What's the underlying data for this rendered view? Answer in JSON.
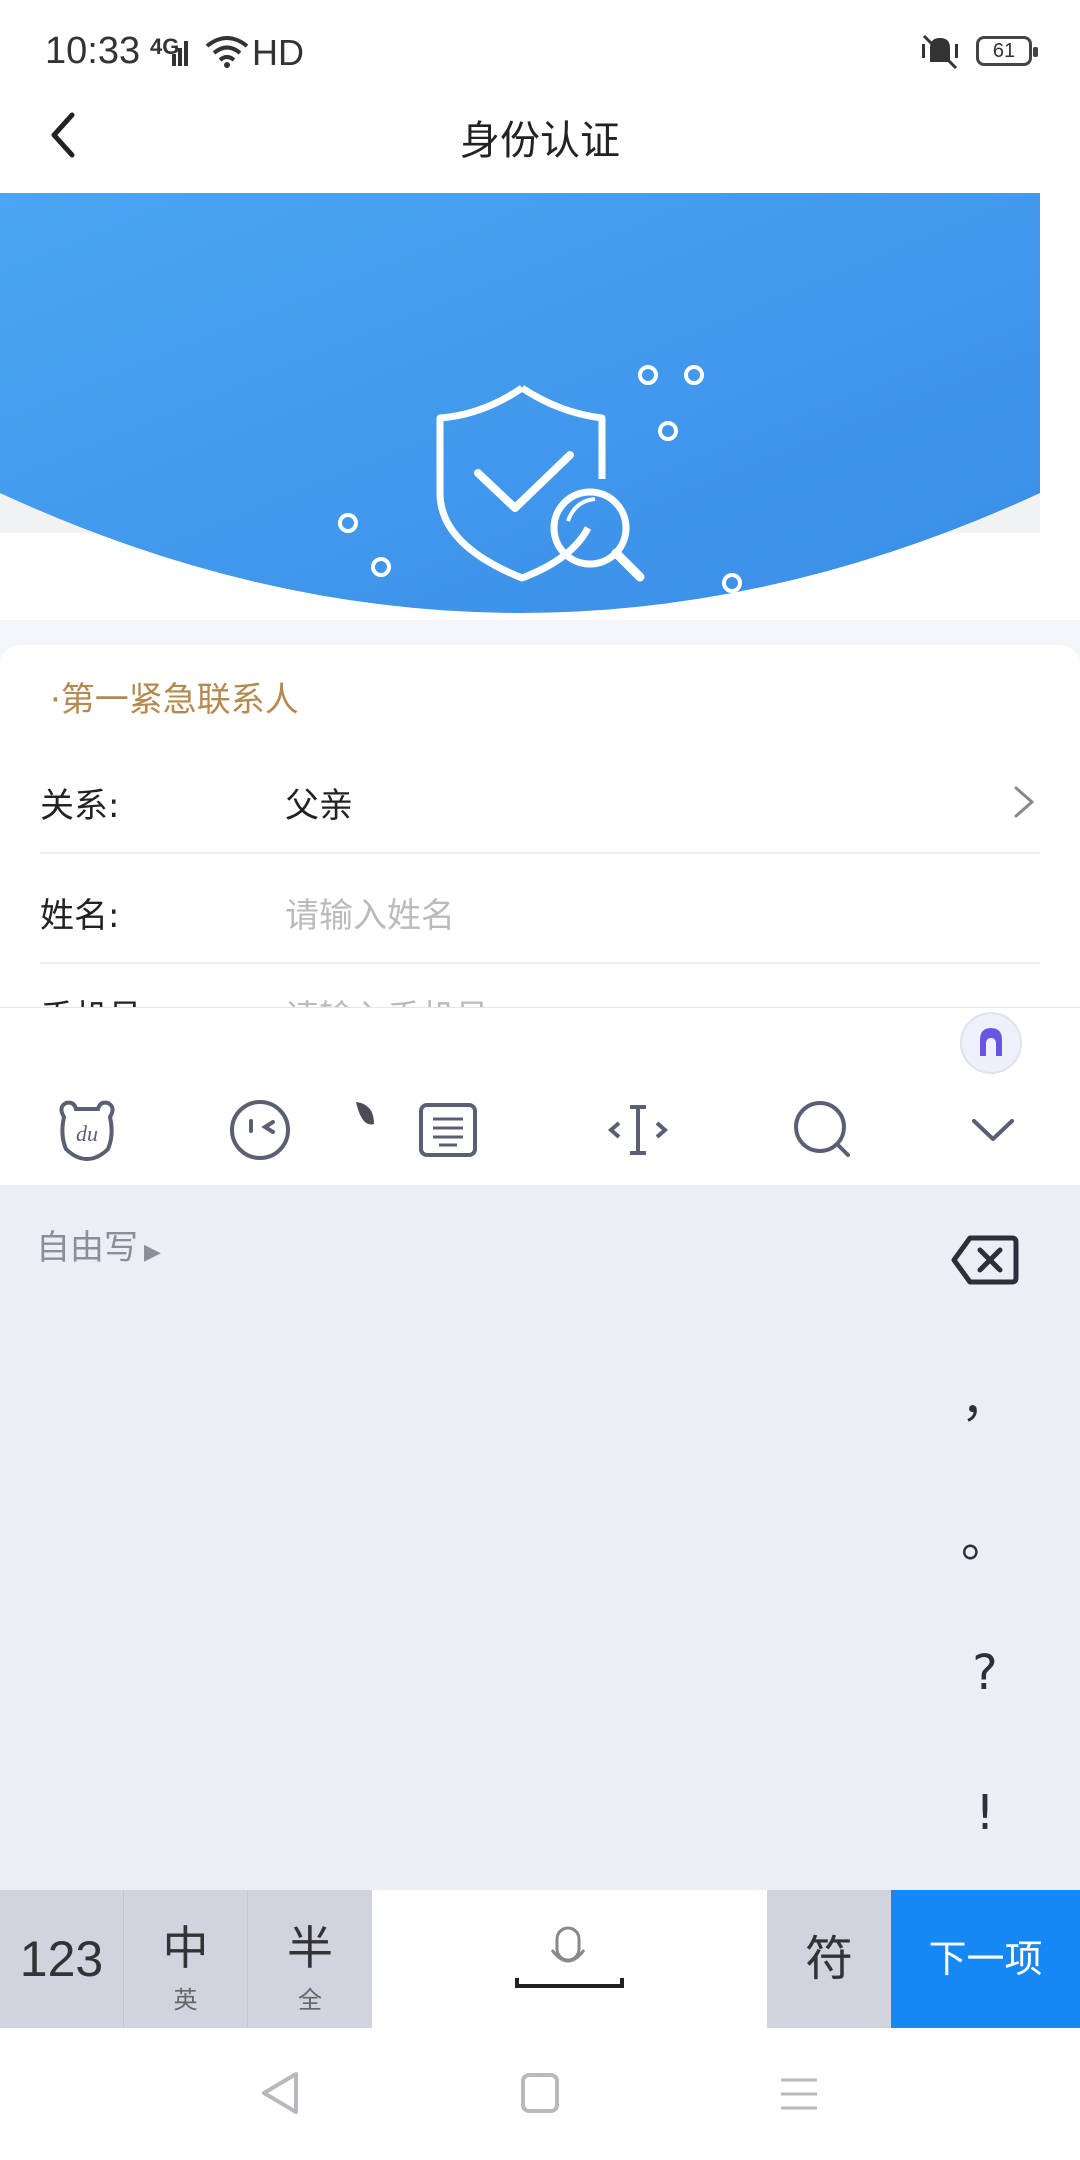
{
  "status_bar": {
    "time": "10:33",
    "network": "4G",
    "signal_label": "HD",
    "battery": "61"
  },
  "header": {
    "title": "身份认证"
  },
  "section": {
    "title": "·第一紧急联系人"
  },
  "form": {
    "relation": {
      "label": "关系:",
      "value": "父亲"
    },
    "name": {
      "label": "姓名:",
      "placeholder": "请输入姓名"
    },
    "phone": {
      "label": "手机号:",
      "placeholder": "请输入手机号"
    }
  },
  "keyboard": {
    "toolbar": [
      "du-logo-icon",
      "emoji-icon",
      "clipboard-icon",
      "cursor-icon",
      "search-icon",
      "collapse-icon"
    ],
    "free_write": "自由写",
    "punctuation": [
      "，",
      "。",
      "?",
      "!"
    ],
    "keys": {
      "num": "123",
      "lang_main": "中",
      "lang_sub": "英",
      "width_main": "半",
      "width_sub": "全",
      "symbol": "符",
      "next": "下一项"
    }
  },
  "colors": {
    "banner": "#3d97ee",
    "accent": "#b58a50",
    "next_key": "#1688f5"
  }
}
